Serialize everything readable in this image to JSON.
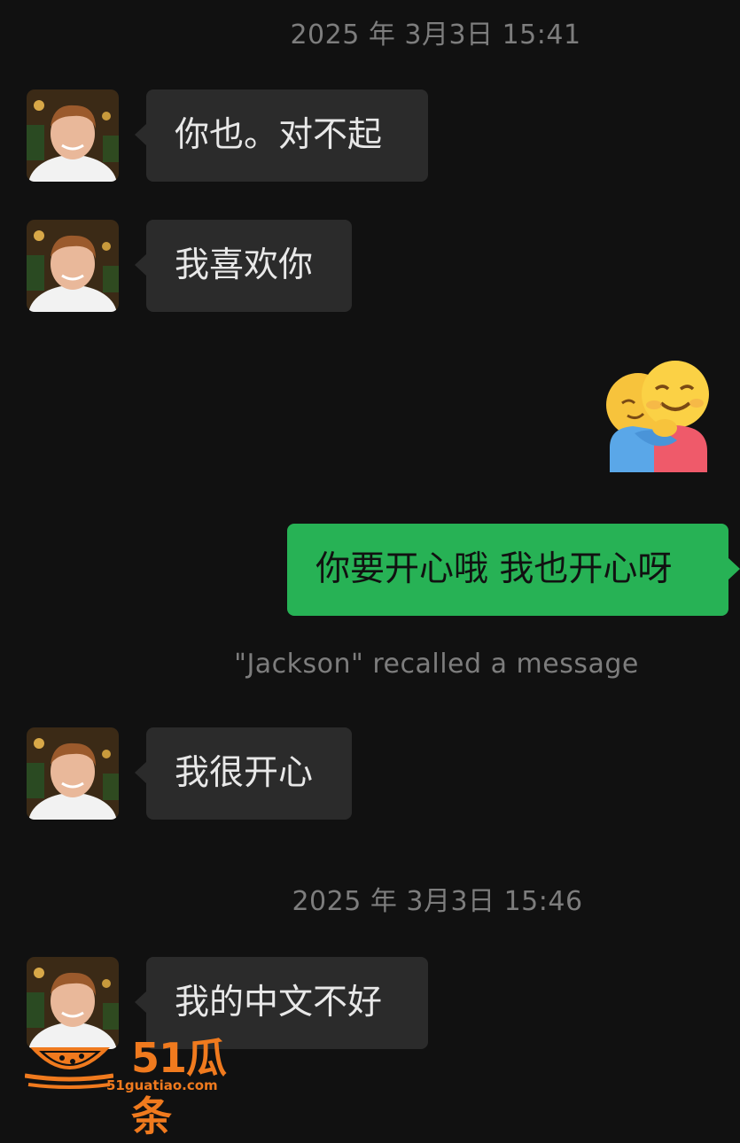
{
  "chat": {
    "timestamps": [
      "2025 年 3月3日 15:41",
      "2025 年 3月3日 15:46"
    ],
    "messages": [
      {
        "text": "你也。对不起"
      },
      {
        "text": "我喜欢你"
      },
      {
        "text": "你要开心哦 我也开心呀"
      },
      {
        "text": "我很开心"
      },
      {
        "text": "我的中文不好"
      }
    ],
    "system_notice": "\"Jackson\" recalled a message",
    "sticker": {
      "icon": "hug-emoji-icon"
    }
  },
  "watermark": {
    "brand": "51瓜条",
    "url": "51guatiao.com"
  },
  "colors": {
    "background": "#111111",
    "incoming_bubble": "#2b2b2b",
    "outgoing_bubble": "#27b255",
    "meta_text": "#7d7d7d",
    "watermark": "#f07a1e"
  }
}
